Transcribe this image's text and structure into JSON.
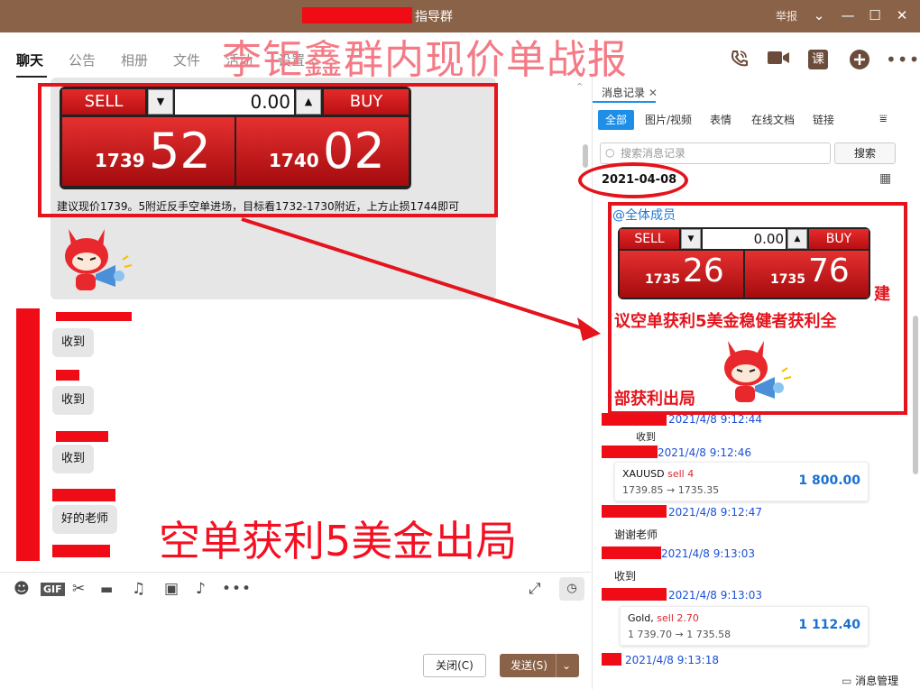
{
  "window": {
    "title": "指导群",
    "report_label": "举报",
    "controls": [
      "⌄",
      "—",
      "☐",
      "✕"
    ]
  },
  "tabs": [
    "聊天",
    "公告",
    "相册",
    "文件",
    "活动",
    "设置 ⌄"
  ],
  "overlay_title": "李钜鑫群内现价单战报",
  "header_icons": [
    "phone-icon",
    "video-icon",
    "course-icon",
    "add-icon",
    "more-icon"
  ],
  "ticket1": {
    "sell": "SELL",
    "buy": "BUY",
    "value": "0.00",
    "sell_small": "1739",
    "sell_big": "52",
    "buy_small": "1740",
    "buy_big": "02"
  },
  "advice": "建议现价1739。5附近反手空单进场，目标看1732-1730附近，上方止损1744即可",
  "chat": [
    {
      "text": "收到"
    },
    {
      "text": "收到"
    },
    {
      "text": "收到"
    },
    {
      "text": "好的老师"
    }
  ],
  "big_overlay": "空单获利5美金出局",
  "toolbar_icons": [
    "emoji-icon",
    "gif-icon",
    "scissors-icon",
    "folder-icon",
    "music-icon",
    "image-icon",
    "bell-icon",
    "more-icon"
  ],
  "toolbar_gif": "GIF",
  "buttons": {
    "close": "关闭(C)",
    "send": "发送(S)",
    "send_arrow": "⌄"
  },
  "right": {
    "head": "消息记录",
    "filters": [
      "全部",
      "图片/视频",
      "表情",
      "在线文档",
      "链接"
    ],
    "search_placeholder": "搜索消息记录",
    "search_btn": "搜索",
    "date": "2021-04-08",
    "mention": "@全体成员",
    "ticket2": {
      "sell": "SELL",
      "buy": "BUY",
      "value": "0.00",
      "sell_small": "1735",
      "sell_big": "26",
      "buy_small": "1735",
      "buy_big": "76"
    },
    "msg_line1": "建",
    "msg_line2": "议空单获利5美金稳健者获利全",
    "msg_line3": "部获利出局",
    "times": [
      "2021/4/8 9:12:44",
      "2021/4/8 9:12:46",
      "2021/4/8 9:12:47",
      "2021/4/8 9:13:03",
      "2021/4/8 9:13:03",
      "2021/4/8 9:13:18"
    ],
    "plain": [
      "收到",
      "谢谢老师",
      "收到"
    ],
    "trade1": {
      "sym": "XAUUSD",
      "dir": "sell 4",
      "prices": "1739.85 → 1735.35",
      "pnl": "1 800.00"
    },
    "trade2": {
      "sym": "Gold,",
      "dir": "sell 2.70",
      "prices": "1 739.70 → 1 735.58",
      "pnl": "1 112.40"
    },
    "manage": "消息管理"
  }
}
